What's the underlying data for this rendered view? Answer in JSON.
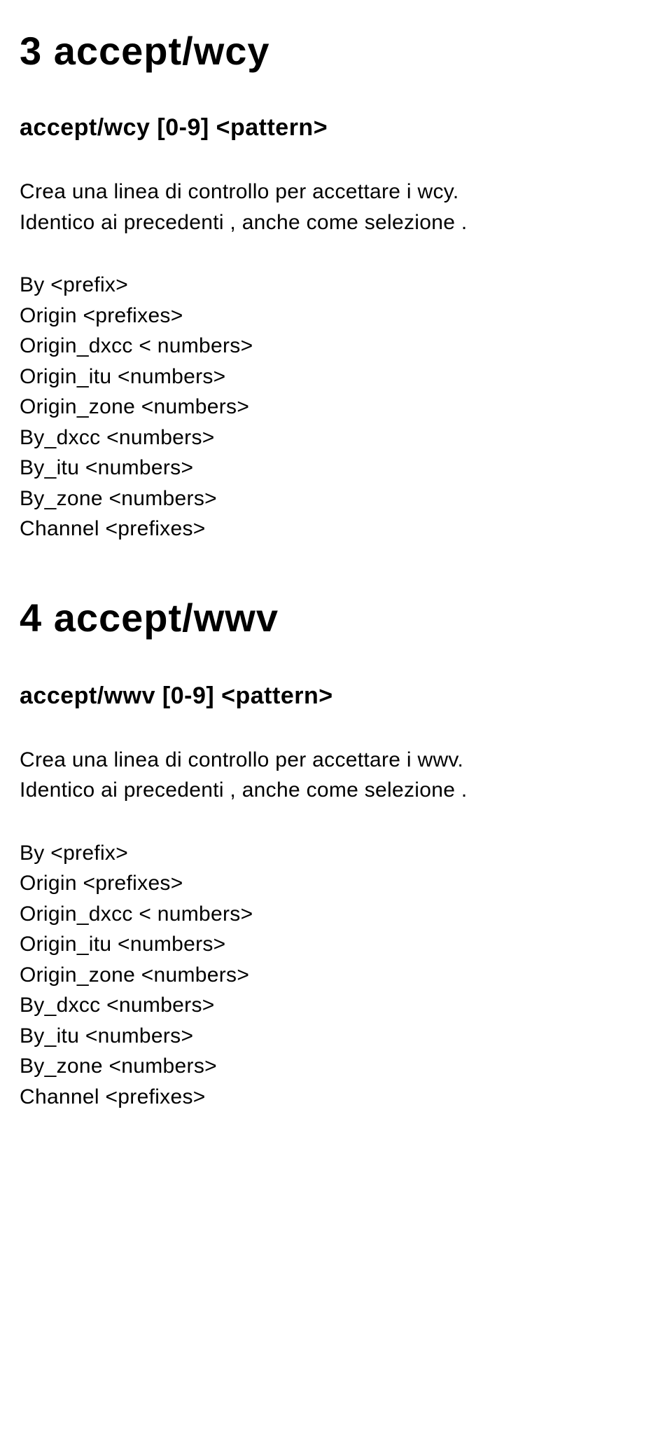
{
  "section1": {
    "heading": "3  accept/wcy",
    "syntax": "accept/wcy [0-9] <pattern>",
    "description_l1": "Crea una linea di controllo per accettare i wcy.",
    "description_l2": "Identico ai precedenti , anche come selezione .",
    "params": [
      "By <prefix>",
      "Origin <prefixes>",
      "Origin_dxcc < numbers>",
      "Origin_itu <numbers>",
      "Origin_zone <numbers>",
      "By_dxcc <numbers>",
      "By_itu <numbers>",
      "By_zone <numbers>",
      "Channel <prefixes>"
    ]
  },
  "section2": {
    "heading": "4  accept/wwv",
    "syntax": "accept/wwv [0-9] <pattern>",
    "description_l1": "Crea una linea di controllo per accettare i wwv.",
    "description_l2": "Identico ai precedenti , anche come selezione .",
    "params": [
      "By <prefix>",
      "Origin <prefixes>",
      "Origin_dxcc < numbers>",
      "Origin_itu <numbers>",
      "Origin_zone <numbers>",
      "By_dxcc <numbers>",
      "By_itu <numbers>",
      "By_zone <numbers>",
      "Channel <prefixes>"
    ]
  }
}
